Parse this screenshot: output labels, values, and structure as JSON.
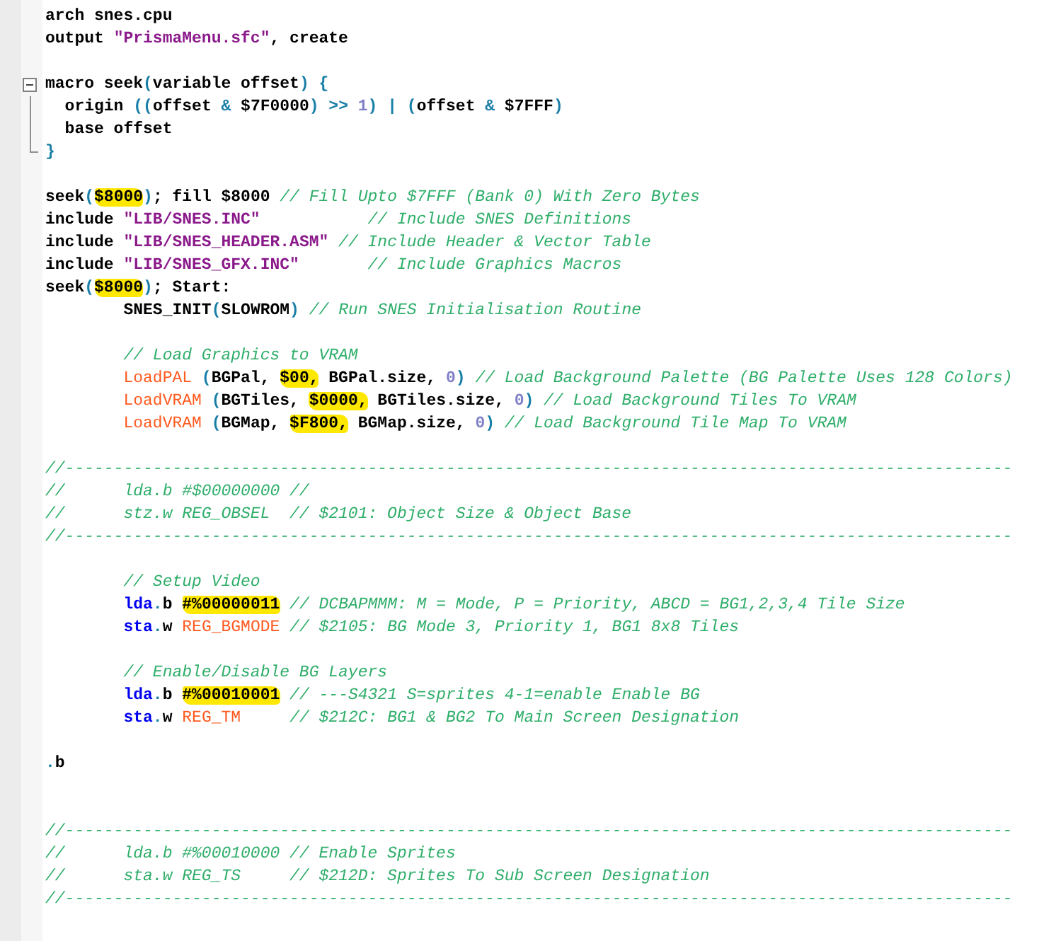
{
  "editor": {
    "lines": [
      {
        "kind": "code",
        "tokens": [
          {
            "text": "arch snes.cpu",
            "kind": "plain"
          }
        ]
      },
      {
        "kind": "code",
        "tokens": [
          {
            "text": "output ",
            "kind": "plain"
          },
          {
            "text": "\"PrismaMenu.sfc\"",
            "kind": "string"
          },
          {
            "text": ", create",
            "kind": "plain"
          }
        ]
      },
      {
        "kind": "blank"
      },
      {
        "kind": "code",
        "expanded": true,
        "tokens": [
          {
            "text": "macro seek",
            "kind": "plain"
          },
          {
            "text": "(",
            "kind": "operator"
          },
          {
            "text": "variable offset",
            "kind": "plain"
          },
          {
            "text": ") {",
            "kind": "operator"
          }
        ],
        "children": [
          {
            "kind": "code",
            "tokens": [
              {
                "text": "  origin ",
                "kind": "plain"
              },
              {
                "text": "((",
                "kind": "operator"
              },
              {
                "text": "offset ",
                "kind": "plain"
              },
              {
                "text": "&",
                "kind": "operator"
              },
              {
                "text": " $7F0000",
                "kind": "plain"
              },
              {
                "text": ") >> ",
                "kind": "operator"
              },
              {
                "text": "1",
                "kind": "number"
              },
              {
                "text": ") | (",
                "kind": "operator"
              },
              {
                "text": "offset ",
                "kind": "plain"
              },
              {
                "text": "&",
                "kind": "operator"
              },
              {
                "text": " $7FFF",
                "kind": "plain"
              },
              {
                "text": ")",
                "kind": "operator"
              }
            ]
          },
          {
            "kind": "code",
            "tokens": [
              {
                "text": "  base offset",
                "kind": "plain"
              }
            ]
          },
          {
            "kind": "code",
            "tokens": [
              {
                "text": "}",
                "kind": "operator"
              }
            ]
          }
        ]
      },
      {
        "kind": "blank"
      },
      {
        "kind": "code",
        "tokens": [
          {
            "text": "seek",
            "kind": "plain"
          },
          {
            "text": "(",
            "kind": "operator"
          },
          {
            "text": "$8000",
            "kind": "plain",
            "highlighted": true
          },
          {
            "text": ")",
            "kind": "operator"
          },
          {
            "text": "; fill $8000 ",
            "kind": "plain"
          },
          {
            "text": "// Fill Upto $7FFF (Bank 0) With Zero Bytes",
            "kind": "comment"
          }
        ]
      },
      {
        "kind": "code",
        "tokens": [
          {
            "text": "include ",
            "kind": "plain"
          },
          {
            "text": "\"LIB/SNES.INC\"",
            "kind": "string"
          },
          {
            "text": "           // Include SNES Definitions",
            "kind": "comment"
          }
        ]
      },
      {
        "kind": "code",
        "tokens": [
          {
            "text": "include ",
            "kind": "plain"
          },
          {
            "text": "\"LIB/SNES_HEADER.ASM\"",
            "kind": "string"
          },
          {
            "text": " // Include Header & Vector Table",
            "kind": "comment"
          }
        ]
      },
      {
        "kind": "code",
        "tokens": [
          {
            "text": "include ",
            "kind": "plain"
          },
          {
            "text": "\"LIB/SNES_GFX.INC\"",
            "kind": "string"
          },
          {
            "text": "       // Include Graphics Macros",
            "kind": "comment"
          }
        ]
      },
      {
        "kind": "code",
        "tokens": [
          {
            "text": "seek",
            "kind": "plain"
          },
          {
            "text": "(",
            "kind": "operator"
          },
          {
            "text": "$8000",
            "kind": "plain",
            "highlighted": true
          },
          {
            "text": ")",
            "kind": "operator"
          },
          {
            "text": "; Start:",
            "kind": "plain"
          }
        ]
      },
      {
        "kind": "code",
        "tokens": [
          {
            "text": "        SNES_INIT",
            "kind": "plain"
          },
          {
            "text": "(",
            "kind": "operator"
          },
          {
            "text": "SLOWROM",
            "kind": "plain"
          },
          {
            "text": ") ",
            "kind": "operator"
          },
          {
            "text": "// Run SNES Initialisation Routine",
            "kind": "comment"
          }
        ]
      },
      {
        "kind": "blank"
      },
      {
        "kind": "code",
        "tokens": [
          {
            "text": "        // Load Graphics to VRAM",
            "kind": "comment"
          }
        ]
      },
      {
        "kind": "code",
        "tokens": [
          {
            "text": "        LoadPAL ",
            "kind": "macro"
          },
          {
            "text": "(",
            "kind": "operator"
          },
          {
            "text": "BGPal, ",
            "kind": "plain"
          },
          {
            "text": "$00,",
            "kind": "plain",
            "highlighted": true
          },
          {
            "text": " BGPal.size, ",
            "kind": "plain"
          },
          {
            "text": "0",
            "kind": "number"
          },
          {
            "text": ") ",
            "kind": "operator"
          },
          {
            "text": "// Load Background Palette (BG Palette Uses 128 Colors)",
            "kind": "comment"
          }
        ]
      },
      {
        "kind": "code",
        "tokens": [
          {
            "text": "        LoadVRAM ",
            "kind": "macro"
          },
          {
            "text": "(",
            "kind": "operator"
          },
          {
            "text": "BGTiles, ",
            "kind": "plain"
          },
          {
            "text": "$0000,",
            "kind": "plain",
            "highlighted": true
          },
          {
            "text": " BGTiles.size, ",
            "kind": "plain"
          },
          {
            "text": "0",
            "kind": "number"
          },
          {
            "text": ") ",
            "kind": "operator"
          },
          {
            "text": "// Load Background Tiles To VRAM",
            "kind": "comment"
          }
        ]
      },
      {
        "kind": "code",
        "tokens": [
          {
            "text": "        LoadVRAM ",
            "kind": "macro"
          },
          {
            "text": "(",
            "kind": "operator"
          },
          {
            "text": "BGMap, ",
            "kind": "plain"
          },
          {
            "text": "$F800,",
            "kind": "plain",
            "highlighted": true
          },
          {
            "text": " BGMap.size, ",
            "kind": "plain"
          },
          {
            "text": "0",
            "kind": "number"
          },
          {
            "text": ") ",
            "kind": "operator"
          },
          {
            "text": "// Load Background Tile Map To VRAM",
            "kind": "comment"
          }
        ]
      },
      {
        "kind": "blank"
      },
      {
        "kind": "code",
        "tokens": [
          {
            "text": "//-------------------------------------------------------------------------------------------------",
            "kind": "comment"
          }
        ]
      },
      {
        "kind": "code",
        "tokens": [
          {
            "text": "//      lda.b #$00000000 //",
            "kind": "comment"
          }
        ]
      },
      {
        "kind": "code",
        "tokens": [
          {
            "text": "//      stz.w REG_OBSEL  // $2101: Object Size & Object Base",
            "kind": "comment"
          }
        ]
      },
      {
        "kind": "code",
        "tokens": [
          {
            "text": "//-------------------------------------------------------------------------------------------------",
            "kind": "comment"
          }
        ]
      },
      {
        "kind": "blank"
      },
      {
        "kind": "code",
        "tokens": [
          {
            "text": "        // Setup Video",
            "kind": "comment"
          }
        ]
      },
      {
        "kind": "code",
        "tokens": [
          {
            "text": "        lda",
            "kind": "instruction"
          },
          {
            "text": ".",
            "kind": "operator"
          },
          {
            "text": "b ",
            "kind": "plain"
          },
          {
            "text": "#%00000011",
            "kind": "plain",
            "highlighted": true
          },
          {
            "text": " // DCBAPMMM: M = Mode, P = Priority, ABCD = BG1,2,3,4 Tile Size",
            "kind": "comment"
          }
        ]
      },
      {
        "kind": "code",
        "tokens": [
          {
            "text": "        sta",
            "kind": "instruction"
          },
          {
            "text": ".",
            "kind": "operator"
          },
          {
            "text": "w ",
            "kind": "plain"
          },
          {
            "text": "REG_BGMODE",
            "kind": "macro"
          },
          {
            "text": " // $2105: BG Mode 3, Priority 1, BG1 8x8 Tiles",
            "kind": "comment"
          }
        ]
      },
      {
        "kind": "blank"
      },
      {
        "kind": "code",
        "tokens": [
          {
            "text": "        // Enable/Disable BG Layers",
            "kind": "comment"
          }
        ]
      },
      {
        "kind": "code",
        "tokens": [
          {
            "text": "        lda",
            "kind": "instruction"
          },
          {
            "text": ".",
            "kind": "operator"
          },
          {
            "text": "b ",
            "kind": "plain"
          },
          {
            "text": "#%00010001",
            "kind": "plain",
            "highlighted": true
          },
          {
            "text": " // ---S4321 S=sprites 4-1=enable Enable BG",
            "kind": "comment"
          }
        ]
      },
      {
        "kind": "code",
        "tokens": [
          {
            "text": "        sta",
            "kind": "instruction"
          },
          {
            "text": ".",
            "kind": "operator"
          },
          {
            "text": "w ",
            "kind": "plain"
          },
          {
            "text": "REG_TM",
            "kind": "macro"
          },
          {
            "text": "     // $212C: BG1 & BG2 To Main Screen Designation",
            "kind": "comment"
          }
        ]
      },
      {
        "kind": "blank"
      },
      {
        "kind": "code",
        "tokens": [
          {
            "text": ".",
            "kind": "operator"
          },
          {
            "text": "b",
            "kind": "plain"
          }
        ]
      },
      {
        "kind": "blank"
      },
      {
        "kind": "blank"
      },
      {
        "kind": "code",
        "tokens": [
          {
            "text": "//-------------------------------------------------------------------------------------------------",
            "kind": "comment"
          }
        ]
      },
      {
        "kind": "code",
        "tokens": [
          {
            "text": "//      lda.b #%00010000 // Enable Sprites",
            "kind": "comment"
          }
        ]
      },
      {
        "kind": "code",
        "tokens": [
          {
            "text": "//      sta.w REG_TS     // $212D: Sprites To Sub Screen Designation",
            "kind": "comment"
          }
        ]
      },
      {
        "kind": "code",
        "tokens": [
          {
            "text": "//-------------------------------------------------------------------------------------------------",
            "kind": "comment"
          }
        ]
      },
      {
        "kind": "blank"
      }
    ]
  }
}
